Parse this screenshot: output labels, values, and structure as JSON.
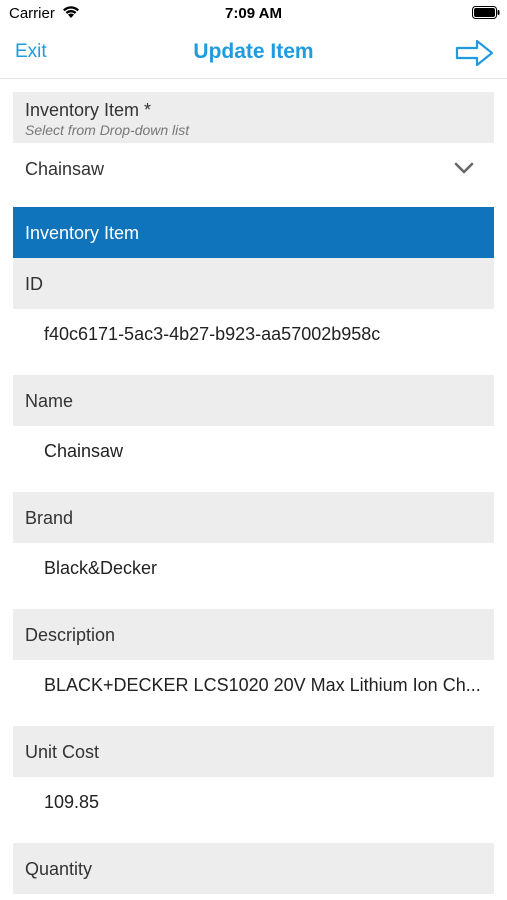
{
  "status_bar": {
    "carrier": "Carrier",
    "time": "7:09 AM"
  },
  "nav": {
    "exit_label": "Exit",
    "title": "Update Item",
    "next_icon": "arrow-right-icon"
  },
  "accent_color": "#1f9be0",
  "section_color": "#0f74bb",
  "inventory_select": {
    "label": "Inventory Item *",
    "hint": "Select from Drop-down list",
    "value": "Chainsaw"
  },
  "section": {
    "title": "Inventory Item"
  },
  "fields": [
    {
      "label": "ID",
      "value": "f40c6171-5ac3-4b27-b923-aa57002b958c"
    },
    {
      "label": "Name",
      "value": "Chainsaw"
    },
    {
      "label": "Brand",
      "value": "Black&Decker"
    },
    {
      "label": "Description",
      "value": "BLACK+DECKER LCS1020 20V Max Lithium Ion Ch..."
    },
    {
      "label": "Unit Cost",
      "value": "109.85"
    },
    {
      "label": "Quantity",
      "value": ""
    }
  ]
}
